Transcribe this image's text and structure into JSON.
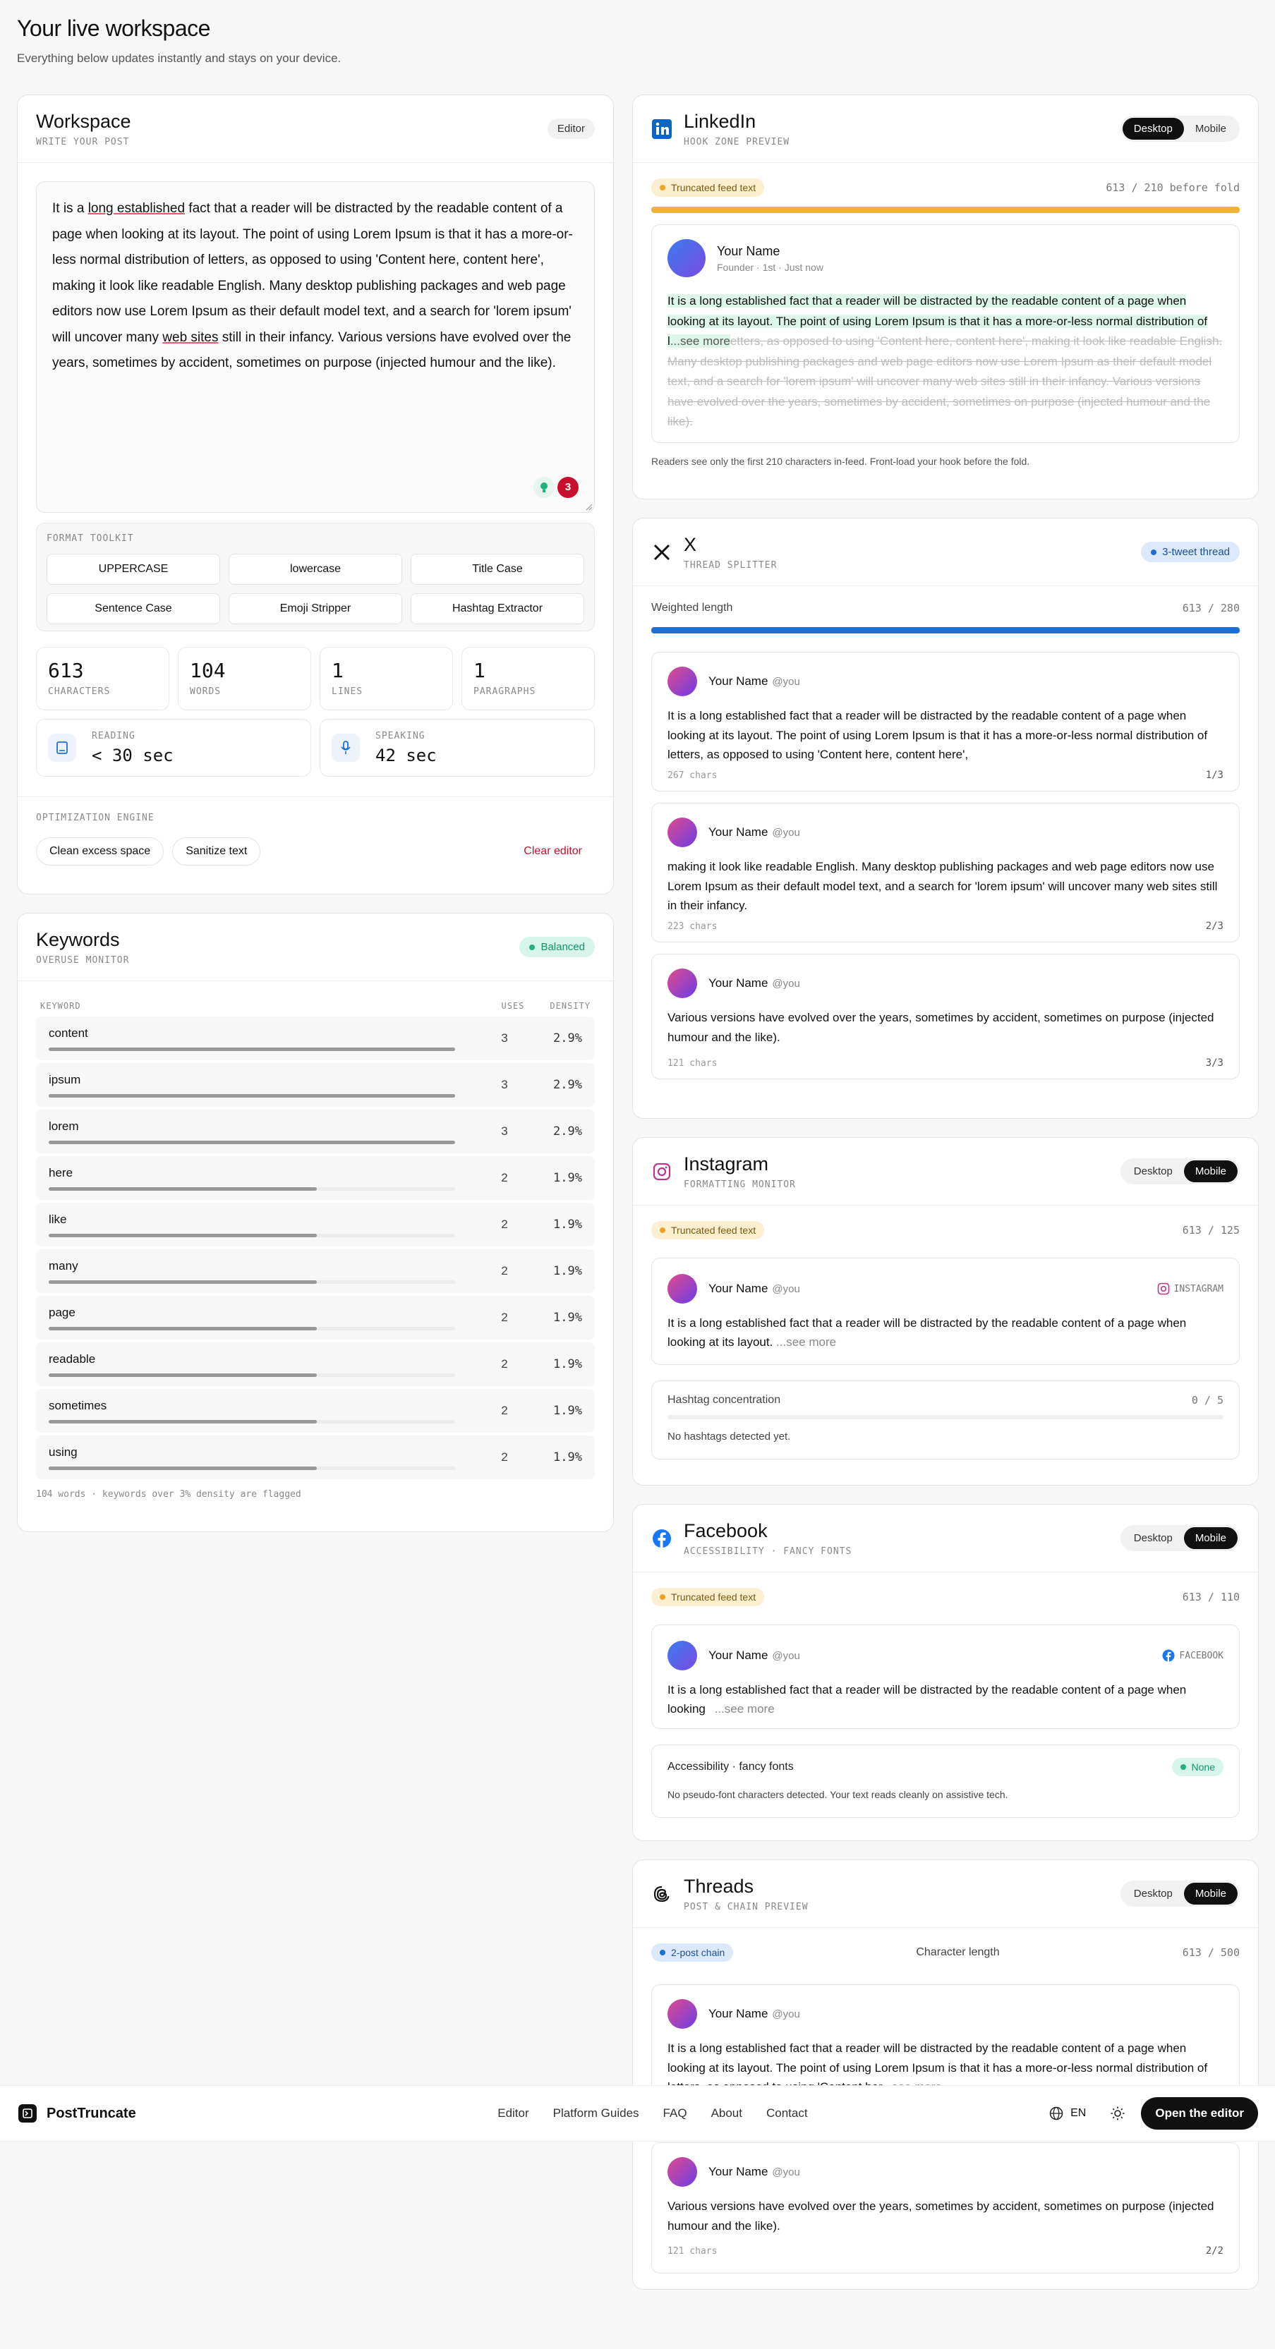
{
  "page": {
    "title": "Your live workspace",
    "subtitle": "Everything below updates instantly and stays on your device."
  },
  "workspace": {
    "title": "Workspace",
    "subtitle": "Write your post",
    "badge": "Editor",
    "text_parts": [
      "It is a ",
      "long established",
      " fact that a reader will be distracted by the readable content of a page when looking at its layout. The point of using Lorem Ipsum is that it has a more-or-less normal distribution of letters, as opposed to using 'Content here, content here', making it look like readable English. Many desktop publishing packages and web page editors now use Lorem Ipsum as their default model text, and a search for 'lorem ipsum' will uncover many ",
      "web sites",
      " still in their infancy. Various versions have evolved over the years, sometimes by accident, sometimes on purpose (injected humour and the like)."
    ],
    "issue_count": "3",
    "toolkit_label": "Format toolkit",
    "toolkit": [
      "UPPERCASE",
      "lowercase",
      "Title Case",
      "Sentence Case",
      "Emoji Stripper",
      "Hashtag Extractor"
    ],
    "stats": [
      {
        "value": "613",
        "label": "Characters"
      },
      {
        "value": "104",
        "label": "Words"
      },
      {
        "value": "1",
        "label": "Lines"
      },
      {
        "value": "1",
        "label": "Paragraphs"
      }
    ],
    "reading": {
      "label": "Reading",
      "value": "< 30 sec"
    },
    "speaking": {
      "label": "Speaking",
      "value": "42 sec"
    },
    "optimization_label": "Optimization engine",
    "clean_btn": "Clean excess space",
    "sanitize_btn": "Sanitize text",
    "clear_btn": "Clear editor"
  },
  "keywords": {
    "title": "Keywords",
    "subtitle": "Overuse monitor",
    "badge": "Balanced",
    "col_keyword": "Keyword",
    "col_uses": "Uses",
    "col_density": "Density",
    "rows": [
      {
        "keyword": "content",
        "uses": "3",
        "density": "2.9%",
        "fill": 1.0
      },
      {
        "keyword": "ipsum",
        "uses": "3",
        "density": "2.9%",
        "fill": 1.0
      },
      {
        "keyword": "lorem",
        "uses": "3",
        "density": "2.9%",
        "fill": 1.0
      },
      {
        "keyword": "here",
        "uses": "2",
        "density": "1.9%",
        "fill": 0.66
      },
      {
        "keyword": "like",
        "uses": "2",
        "density": "1.9%",
        "fill": 0.66
      },
      {
        "keyword": "many",
        "uses": "2",
        "density": "1.9%",
        "fill": 0.66
      },
      {
        "keyword": "page",
        "uses": "2",
        "density": "1.9%",
        "fill": 0.66
      },
      {
        "keyword": "readable",
        "uses": "2",
        "density": "1.9%",
        "fill": 0.66
      },
      {
        "keyword": "sometimes",
        "uses": "2",
        "density": "1.9%",
        "fill": 0.66
      },
      {
        "keyword": "using",
        "uses": "2",
        "density": "1.9%",
        "fill": 0.66
      }
    ],
    "footer": "104 words · keywords over 3% density are flagged"
  },
  "linkedin": {
    "title": "LinkedIn",
    "subtitle": "Hook zone preview",
    "seg_desktop": "Desktop",
    "seg_mobile": "Mobile",
    "badge": "Truncated feed text",
    "count": "613 / 210 before fold",
    "progress": 1.0,
    "name": "Your Name",
    "meta": "Founder · 1st · Just now",
    "visible": "It is a long established fact that a reader will be distracted by the readable content of a page when looking at its layout. The point of using Lorem Ipsum is that it has a more-or-less normal distribution of l",
    "see_more": "...see more",
    "hidden": "etters, as opposed to using 'Content here, content here', making it look like readable English. Many desktop publishing packages and web page editors now use Lorem Ipsum as their default model text, and a search for 'lorem ipsum' will uncover many web sites still in their infancy. Various versions have evolved over the years, sometimes by accident, sometimes on purpose (injected humour and the like).",
    "note": "Readers see only the first 210 characters in-feed. Front-load your hook before the fold."
  },
  "x": {
    "title": "X",
    "subtitle": "Thread splitter",
    "badge": "3-tweet thread",
    "weighted_label": "Weighted length",
    "count": "613 / 280",
    "progress": 1.0,
    "tweets": [
      {
        "name": "Your Name",
        "handle": "@you",
        "text": "It is a long established fact that a reader will be distracted by the readable content of a page when looking at its layout. The point of using Lorem Ipsum is that it has a more-or-less normal distribution of letters, as opposed to using 'Content here, content here',",
        "chars": "267 chars",
        "pos": "1/3"
      },
      {
        "name": "Your Name",
        "handle": "@you",
        "text": "making it look like readable English. Many desktop publishing packages and web page editors now use Lorem Ipsum as their default model text, and a search for 'lorem ipsum' will uncover many web sites still in their infancy.",
        "chars": "223 chars",
        "pos": "2/3"
      },
      {
        "name": "Your Name",
        "handle": "@you",
        "text": "Various versions have evolved over the years, sometimes by accident, sometimes on purpose (injected humour and the like).",
        "chars": "121 chars",
        "pos": "3/3"
      }
    ]
  },
  "instagram": {
    "title": "Instagram",
    "subtitle": "Formatting monitor",
    "seg_desktop": "Desktop",
    "seg_mobile": "Mobile",
    "badge": "Truncated feed text",
    "count": "613 / 125",
    "name": "Your Name",
    "handle": "@you",
    "tag": "INSTAGRAM",
    "text": "It is a long established fact that a reader will be distracted by the readable content of a page when looking at its layout.",
    "see_more": "...see more",
    "hashtag_label": "Hashtag concentration",
    "hashtag_count": "0 / 5",
    "hashtag_note": "No hashtags detected yet."
  },
  "facebook": {
    "title": "Facebook",
    "subtitle": "Accessibility · Fancy fonts",
    "seg_desktop": "Desktop",
    "seg_mobile": "Mobile",
    "badge": "Truncated feed text",
    "count": "613 / 110",
    "name": "Your Name",
    "handle": "@you",
    "tag": "FACEBOOK",
    "text": "It is a long established fact that a reader will be distracted by the readable content of a page when looking ",
    "see_more": "...see more",
    "acc_label": "Accessibility · fancy fonts",
    "acc_badge": "None",
    "acc_note": "No pseudo-font characters detected. Your text reads cleanly on assistive tech."
  },
  "threads": {
    "title": "Threads",
    "subtitle": "Post & chain preview",
    "seg_desktop": "Desktop",
    "seg_mobile": "Mobile",
    "badge": "2-post chain",
    "length_label": "Character length",
    "count": "613 / 500",
    "posts": [
      {
        "name": "Your Name",
        "handle": "@you",
        "text": "It is a long established fact that a reader will be distracted by the readable content of a page when looking at its layout. The point of using Lorem Ipsum is that it has a more-or-less normal distribution of letters, as opposed to using 'Content her",
        "see_more": "...see more"
      },
      {
        "name": "Your Name",
        "handle": "@you",
        "text": "Various versions have evolved over the years, sometimes by accident, sometimes on purpose (injected humour and the like).",
        "chars": "121 chars",
        "pos": "2/2"
      }
    ]
  },
  "nav": {
    "brand": "PostTruncate",
    "links": [
      "Editor",
      "Platform Guides",
      "FAQ",
      "About",
      "Contact"
    ],
    "lang": "EN",
    "cta": "Open the editor"
  },
  "colors": {
    "accent_green": "#22b07d",
    "orange": "#f0b23a",
    "blue": "#1d6fd6",
    "red": "#c8102e"
  }
}
